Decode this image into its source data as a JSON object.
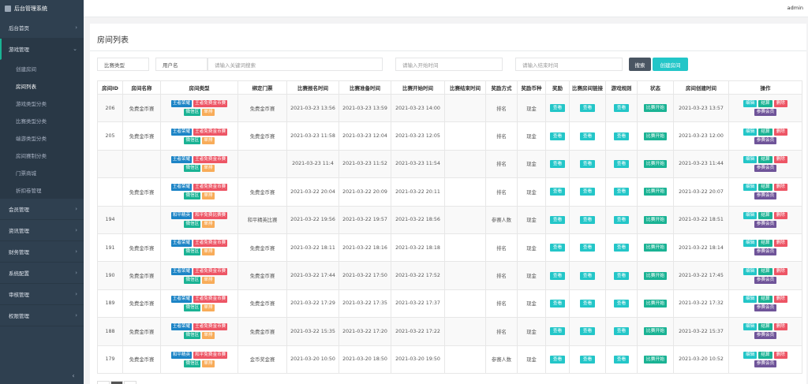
{
  "app": {
    "title": "后台管理系统",
    "user": "admin"
  },
  "sidebar": {
    "items": [
      {
        "label": "后台首页",
        "chevron": "›"
      },
      {
        "label": "游戏管理",
        "chevron": "⌄"
      },
      {
        "label": "会员管理",
        "chevron": "›"
      },
      {
        "label": "资讯管理",
        "chevron": "›"
      },
      {
        "label": "财务管理",
        "chevron": "›"
      },
      {
        "label": "系统配置",
        "chevron": "›"
      },
      {
        "label": "审核管理",
        "chevron": "›"
      },
      {
        "label": "权限管理",
        "chevron": "›"
      }
    ],
    "subitems": [
      "创建房间",
      "房间列表",
      "游戏类型分类",
      "比赛类型分类",
      "端游类型分类",
      "房间赛制分类",
      "门票商城",
      "折扣卷管理"
    ],
    "collapse": "‹"
  },
  "page": {
    "title": "房间列表",
    "filters": {
      "match_type": "比赛类型",
      "username": "用户名",
      "keyword_ph": "请输入关键词搜索",
      "start_ph": "请输入开始时间",
      "end_ph": "请输入结束时间",
      "search": "搜索",
      "create": "创建房间"
    }
  },
  "table": {
    "headers": [
      "房间ID",
      "房间名称",
      "房间类型",
      "绑定门票",
      "比赛报名时间",
      "比赛准备时间",
      "比赛开始时间",
      "比赛结束时间",
      "奖励方式",
      "奖励币种",
      "奖励",
      "比赛房间链接",
      "游戏规则",
      "状态",
      "房间创建时间",
      "操作"
    ],
    "view_label": "查看",
    "status_label": "比赛开始",
    "ops": {
      "edit": "编辑",
      "settle": "结算",
      "delete": "删除",
      "members": "参赛会员"
    },
    "rows": [
      {
        "id": "206",
        "name": "免费金币赛",
        "t1": "王者荣耀",
        "t2": "王者免费金币赛",
        "t3": "微信区",
        "t4": "单排",
        "ticket": "免费金币赛",
        "signup": "2021-03-23 13:56",
        "prepare": "2021-03-23 13:59",
        "start": "2021-03-23 14:00",
        "end": "",
        "reward_mode": "排名",
        "currency": "现金",
        "created": "2021-03-23 13:57"
      },
      {
        "id": "205",
        "name": "免费金币赛",
        "t1": "王者荣耀",
        "t2": "王者免费金币赛",
        "t3": "微信区",
        "t4": "单排",
        "ticket": "免费金币赛",
        "signup": "2021-03-23 11:58",
        "prepare": "2021-03-23 12:04",
        "start": "2021-03-23 12:05",
        "end": "",
        "reward_mode": "排名",
        "currency": "现金",
        "created": "2021-03-23 12:00"
      },
      {
        "id": "",
        "name": "",
        "t1": "王者荣耀",
        "t2": "王者免费金币赛",
        "t3": "微信区",
        "t4": "单排",
        "ticket": "",
        "signup": "2021-03-23 11:4",
        "prepare": "2021-03-23 11:52",
        "start": "2021-03-23 11:54",
        "end": "",
        "reward_mode": "排名",
        "currency": "现金",
        "created": "2021-03-23 11:44"
      },
      {
        "id": "",
        "name": "免费金币赛",
        "t1": "王者荣耀",
        "t2": "王者免费金币赛",
        "t3": "微信区",
        "t4": "单排",
        "ticket": "免费金币赛",
        "signup": "2021-03-22 20:04",
        "prepare": "2021-03-22 20:09",
        "start": "2021-03-22 20:11",
        "end": "",
        "reward_mode": "排名",
        "currency": "现金",
        "created": "2021-03-22 20:07"
      },
      {
        "id": "194",
        "name": "",
        "t1": "和平精英",
        "t2": "和平免费比赛赛",
        "t3": "微信区",
        "t4": "单排",
        "ticket": "和平精英比赛",
        "signup": "2021-03-22 19:56",
        "prepare": "2021-03-22 19:57",
        "start": "2021-03-22 18:56",
        "end": "",
        "reward_mode": "参赛人数",
        "currency": "现金",
        "created": "2021-03-22 18:51"
      },
      {
        "id": "191",
        "name": "免费金币赛",
        "t1": "王者荣耀",
        "t2": "王者免费金币赛",
        "t3": "微信区",
        "t4": "单排",
        "ticket": "免费金币赛",
        "signup": "2021-03-22 18:11",
        "prepare": "2021-03-22 18:16",
        "start": "2021-03-22 18:18",
        "end": "",
        "reward_mode": "排名",
        "currency": "现金",
        "created": "2021-03-22 18:14"
      },
      {
        "id": "190",
        "name": "免费金币赛",
        "t1": "王者荣耀",
        "t2": "王者免费金币赛",
        "t3": "微信区",
        "t4": "单排",
        "ticket": "免费金币赛",
        "signup": "2021-03-22 17:44",
        "prepare": "2021-03-22 17:50",
        "start": "2021-03-22 17:52",
        "end": "",
        "reward_mode": "排名",
        "currency": "现金",
        "created": "2021-03-22 17:45"
      },
      {
        "id": "189",
        "name": "免费金币赛",
        "t1": "王者荣耀",
        "t2": "王者免费金币赛",
        "t3": "微信区",
        "t4": "单排",
        "ticket": "免费金币赛",
        "signup": "2021-03-22 17:29",
        "prepare": "2021-03-22 17:35",
        "start": "2021-03-22 17:37",
        "end": "",
        "reward_mode": "排名",
        "currency": "现金",
        "created": "2021-03-22 17:32"
      },
      {
        "id": "188",
        "name": "免费金币赛",
        "t1": "王者荣耀",
        "t2": "王者免费金币赛",
        "t3": "微信区",
        "t4": "单排",
        "ticket": "免费金币赛",
        "signup": "2021-03-22 15:35",
        "prepare": "2021-03-22 17:20",
        "start": "2021-03-22 17:22",
        "end": "",
        "reward_mode": "排名",
        "currency": "现金",
        "created": "2021-03-22 15:37"
      },
      {
        "id": "179",
        "name": "免费金币赛",
        "t1": "和平精英",
        "t2": "和平免费金币赛",
        "t3": "微信区",
        "t4": "单排",
        "ticket": "金币奖金赛",
        "signup": "2021-03-20 10:50",
        "prepare": "2021-03-20 18:50",
        "start": "2021-03-20 19:50",
        "end": "",
        "reward_mode": "参赛人数",
        "currency": "现金",
        "created": "2021-03-20 10:52"
      }
    ]
  }
}
